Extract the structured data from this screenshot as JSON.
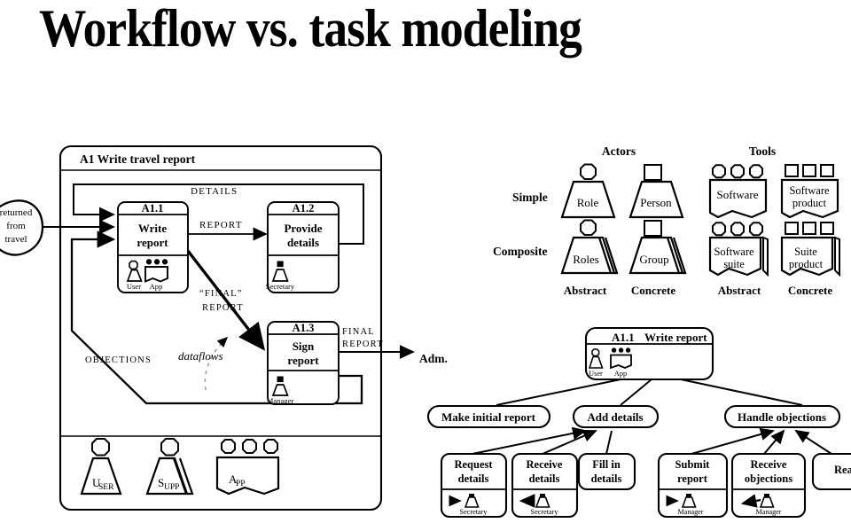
{
  "slide": {
    "title": "Workflow vs. task modeling"
  },
  "workflow": {
    "frame_title": "A1 Write travel report",
    "external_input": "returned\nfrom\ntravel",
    "external_input_lines": [
      "returned",
      "from",
      "travel"
    ],
    "external_output": "Adm.",
    "flows": {
      "details": "DETAILS",
      "report": "REPORT",
      "final_report_quoted_1": "“FINAL”",
      "final_report_quoted_2": "REPORT",
      "objections": "OBJECTIONS",
      "final_report_out_1": "FINAL",
      "final_report_out_2": "REPORT",
      "dataflows_annotation": "dataflows"
    },
    "activities": [
      {
        "id": "A1.1",
        "name_line1": "Write",
        "name_line2": "report",
        "resources": [
          {
            "label": "User",
            "kind": "actor-abstract-simple"
          },
          {
            "label": "App",
            "kind": "tool-abstract-simple"
          }
        ]
      },
      {
        "id": "A1.2",
        "name_line1": "Provide",
        "name_line2": "details",
        "resources": [
          {
            "label": "Secretary",
            "kind": "actor-concrete-simple"
          }
        ]
      },
      {
        "id": "A1.3",
        "name_line1": "Sign",
        "name_line2": "report",
        "resources": [
          {
            "label": "Manager",
            "kind": "actor-concrete-simple"
          }
        ]
      }
    ],
    "resource_pool": [
      {
        "label_big": "U",
        "label_small": "SER",
        "kind": "actor-abstract-simple"
      },
      {
        "label_big": "S",
        "label_small": "UPP",
        "kind": "actor-abstract-composite"
      },
      {
        "label_big": "A",
        "label_small": "PP",
        "kind": "tool-abstract-simple"
      }
    ]
  },
  "legend": {
    "actors_title": "Actors",
    "tools_title": "Tools",
    "row_labels": [
      "Simple",
      "Composite"
    ],
    "column_labels": [
      "Abstract",
      "Concrete",
      "Abstract",
      "Concrete"
    ],
    "cells": [
      {
        "label": "Role",
        "group": "actors",
        "row": "Simple",
        "col": "Abstract"
      },
      {
        "label": "Person",
        "group": "actors",
        "row": "Simple",
        "col": "Concrete"
      },
      {
        "label": "Roles",
        "group": "actors",
        "row": "Composite",
        "col": "Abstract"
      },
      {
        "label": "Group",
        "group": "actors",
        "row": "Composite",
        "col": "Concrete"
      },
      {
        "label": "Software",
        "group": "tools",
        "row": "Simple",
        "col": "Abstract"
      },
      {
        "label_1": "Software",
        "label_2": "product",
        "group": "tools",
        "row": "Simple",
        "col": "Concrete"
      },
      {
        "label_1": "Software",
        "label_2": "suite",
        "group": "tools",
        "row": "Composite",
        "col": "Abstract"
      },
      {
        "label_1": "Suite",
        "label_2": "product",
        "group": "tools",
        "row": "Composite",
        "col": "Concrete"
      }
    ]
  },
  "task_tree": {
    "root": {
      "id": "A1.1",
      "name": "Write report",
      "resources": [
        {
          "label": "User",
          "kind": "actor-abstract-simple"
        },
        {
          "label": "App",
          "kind": "tool-abstract-simple"
        }
      ]
    },
    "level2": [
      {
        "name": "Make initial report"
      },
      {
        "name": "Add details"
      },
      {
        "name": "Handle objections"
      }
    ],
    "leaves": [
      {
        "name_line1": "Request",
        "name_line2": "details",
        "actor": "Secretary",
        "direction": "out"
      },
      {
        "name_line1": "Receive",
        "name_line2": "details",
        "actor": "Secretary",
        "direction": "in"
      },
      {
        "name_line1": "Fill in",
        "name_line2": "details",
        "actor": null,
        "direction": null
      },
      {
        "name_line1": "Submit",
        "name_line2": "report",
        "actor": "Manager",
        "direction": "out"
      },
      {
        "name_line1": "Receive",
        "name_line2": "objections",
        "actor": "Manager",
        "direction": "in"
      },
      {
        "name_line1": "React",
        "name_line2": "",
        "actor": null,
        "direction": null
      }
    ]
  },
  "colors": {
    "ink": "#000000",
    "paper": "#ffffff"
  }
}
